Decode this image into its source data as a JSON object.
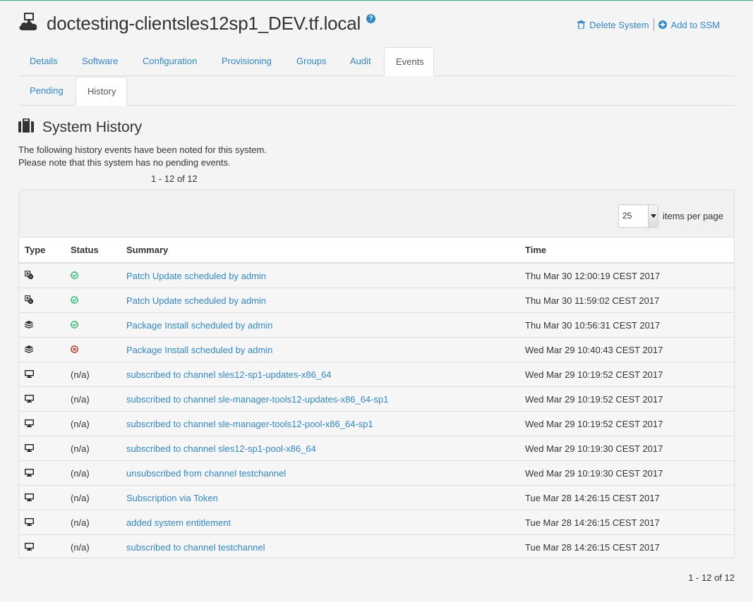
{
  "header": {
    "title": "doctesting-clientsles12sp1_DEV.tf.local",
    "help": "?",
    "delete_label": "Delete System",
    "ssm_label": "Add to SSM"
  },
  "tabs": [
    {
      "label": "Details",
      "active": false
    },
    {
      "label": "Software",
      "active": false
    },
    {
      "label": "Configuration",
      "active": false
    },
    {
      "label": "Provisioning",
      "active": false
    },
    {
      "label": "Groups",
      "active": false
    },
    {
      "label": "Audit",
      "active": false
    },
    {
      "label": "Events",
      "active": true
    }
  ],
  "subtabs": [
    {
      "label": "Pending",
      "active": false
    },
    {
      "label": "History",
      "active": true
    }
  ],
  "section": {
    "title": "System History",
    "line1": "The following history events have been noted for this system.",
    "line2": "Please note that this system has no pending events."
  },
  "pagination": {
    "range_top": "1 - 12 of 12",
    "range_bottom": "1 - 12 of 12",
    "per_page": "25",
    "per_page_label": "items per page"
  },
  "table": {
    "headers": {
      "type": "Type",
      "status": "Status",
      "summary": "Summary",
      "time": "Time"
    },
    "rows": [
      {
        "type_icon": "patch-icon",
        "status_icon": "success-icon",
        "status": "",
        "summary": "Patch Update scheduled by admin",
        "time": "Thu Mar 30 12:00:19 CEST 2017"
      },
      {
        "type_icon": "patch-icon",
        "status_icon": "success-icon",
        "status": "",
        "summary": "Patch Update scheduled by admin",
        "time": "Thu Mar 30 11:59:02 CEST 2017"
      },
      {
        "type_icon": "package-icon",
        "status_icon": "success-icon",
        "status": "",
        "summary": "Package Install scheduled by admin",
        "time": "Thu Mar 30 10:56:31 CEST 2017"
      },
      {
        "type_icon": "package-icon",
        "status_icon": "failed-icon",
        "status": "",
        "summary": "Package Install scheduled by admin",
        "time": "Wed Mar 29 10:40:43 CEST 2017"
      },
      {
        "type_icon": "desktop-icon",
        "status_icon": "",
        "status": "(n/a)",
        "summary": "subscribed to channel sles12-sp1-updates-x86_64",
        "time": "Wed Mar 29 10:19:52 CEST 2017"
      },
      {
        "type_icon": "desktop-icon",
        "status_icon": "",
        "status": "(n/a)",
        "summary": "subscribed to channel sle-manager-tools12-updates-x86_64-sp1",
        "time": "Wed Mar 29 10:19:52 CEST 2017"
      },
      {
        "type_icon": "desktop-icon",
        "status_icon": "",
        "status": "(n/a)",
        "summary": "subscribed to channel sle-manager-tools12-pool-x86_64-sp1",
        "time": "Wed Mar 29 10:19:52 CEST 2017"
      },
      {
        "type_icon": "desktop-icon",
        "status_icon": "",
        "status": "(n/a)",
        "summary": "subscribed to channel sles12-sp1-pool-x86_64",
        "time": "Wed Mar 29 10:19:30 CEST 2017"
      },
      {
        "type_icon": "desktop-icon",
        "status_icon": "",
        "status": "(n/a)",
        "summary": "unsubscribed from channel testchannel",
        "time": "Wed Mar 29 10:19:30 CEST 2017"
      },
      {
        "type_icon": "desktop-icon",
        "status_icon": "",
        "status": "(n/a)",
        "summary": "Subscription via Token",
        "time": "Tue Mar 28 14:26:15 CEST 2017"
      },
      {
        "type_icon": "desktop-icon",
        "status_icon": "",
        "status": "(n/a)",
        "summary": "added system entitlement",
        "time": "Tue Mar 28 14:26:15 CEST 2017"
      },
      {
        "type_icon": "desktop-icon",
        "status_icon": "",
        "status": "(n/a)",
        "summary": "subscribed to channel testchannel",
        "time": "Tue Mar 28 14:26:15 CEST 2017"
      }
    ]
  },
  "colors": {
    "accent": "#30ba78",
    "link": "#2f88c8",
    "success": "#30ba78",
    "failed": "#c0392b"
  }
}
